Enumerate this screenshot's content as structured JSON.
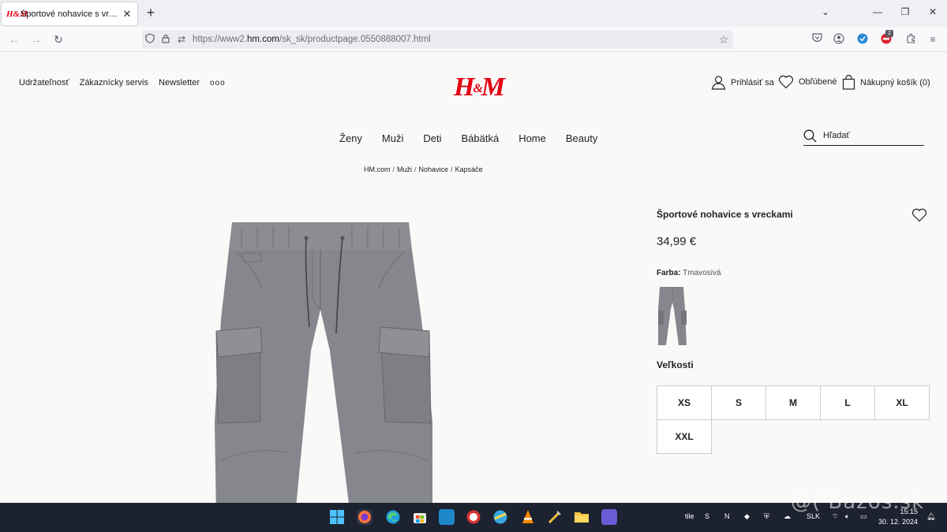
{
  "browser": {
    "tab_title": "Športové nohavice s vreckami -",
    "tab_favicon": "H&M",
    "url_prefix": "https://www2.",
    "url_domain": "hm.com",
    "url_path": "/sk_sk/productpage.0550888007.html",
    "extension_badge": "2"
  },
  "header": {
    "top_links": [
      "Udržateľnosť",
      "Zákaznícky servis",
      "Newsletter"
    ],
    "more": "ooo",
    "logo": "H&M",
    "login": "Prihlásiť sa",
    "favorites": "Obľúbené",
    "cart": "Nákupný košík (0)"
  },
  "nav": {
    "items": [
      "Ženy",
      "Muži",
      "Deti",
      "Bábätká",
      "Home",
      "Beauty"
    ],
    "search_placeholder": "Hľadať"
  },
  "breadcrumb": [
    "HM.com",
    "Muži",
    "Nohavice",
    "Kapsáče"
  ],
  "product": {
    "name": "Športové nohavice s vreckami",
    "price": "34,99 €",
    "color_label": "Farba:",
    "color_value": "Tmavosivá",
    "sizes_title": "Veľkosti",
    "sizes": [
      "XS",
      "S",
      "M",
      "L",
      "XL",
      "XXL"
    ]
  },
  "taskbar": {
    "tray_label": "tile",
    "language": "SLK",
    "time": "15:15",
    "date": "30. 12. 2024",
    "watermark": "@( Bazos.sk"
  },
  "colors": {
    "brand_red": "#e50010",
    "pants_gray": "#85878d",
    "taskbar": "#1c2230"
  }
}
